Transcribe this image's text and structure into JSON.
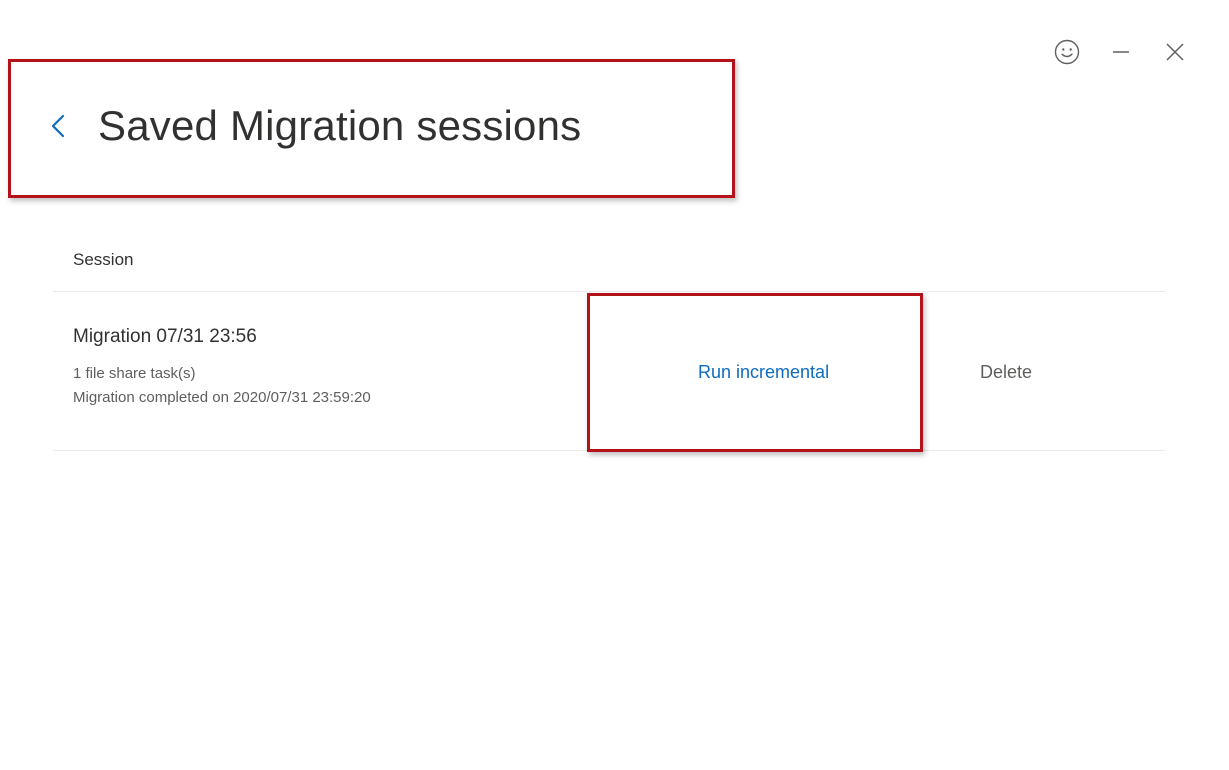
{
  "header": {
    "title": "Saved Migration sessions",
    "back_icon": "chevron-left-icon"
  },
  "window_controls": {
    "feedback_icon": "smiley-icon",
    "minimize_icon": "minimize-icon",
    "close_icon": "close-icon"
  },
  "table": {
    "columns": [
      "Session"
    ],
    "rows": [
      {
        "name": "Migration 07/31 23:56",
        "tasks": "1 file share task(s)",
        "status": "Migration completed on 2020/07/31 23:59:20",
        "run_label": "Run incremental",
        "delete_label": "Delete"
      }
    ]
  },
  "colors": {
    "accent": "#0f6cbd",
    "highlight": "#b3121a",
    "text": "#323130",
    "secondary_text": "#605e5c"
  }
}
